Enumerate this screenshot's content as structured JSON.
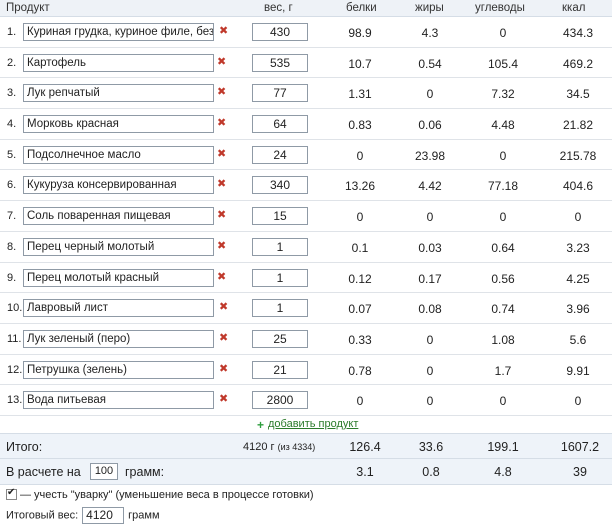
{
  "header": {
    "product": "Продукт",
    "weight": "вес, г",
    "protein": "белки",
    "fat": "жиры",
    "carbs": "углеводы",
    "kcal": "ккал"
  },
  "rows": [
    {
      "num": "1.",
      "name": "Куриная грудка, куриное филе, без",
      "weight": "430",
      "protein": "98.9",
      "fat": "4.3",
      "carbs": "0",
      "kcal": "434.3"
    },
    {
      "num": "2.",
      "name": "Картофель",
      "weight": "535",
      "protein": "10.7",
      "fat": "0.54",
      "carbs": "105.4",
      "kcal": "469.2"
    },
    {
      "num": "3.",
      "name": "Лук репчатый",
      "weight": "77",
      "protein": "1.31",
      "fat": "0",
      "carbs": "7.32",
      "kcal": "34.5"
    },
    {
      "num": "4.",
      "name": "Морковь красная",
      "weight": "64",
      "protein": "0.83",
      "fat": "0.06",
      "carbs": "4.48",
      "kcal": "21.82"
    },
    {
      "num": "5.",
      "name": "Подсолнечное масло",
      "weight": "24",
      "protein": "0",
      "fat": "23.98",
      "carbs": "0",
      "kcal": "215.78"
    },
    {
      "num": "6.",
      "name": "Кукуруза консервированная",
      "weight": "340",
      "protein": "13.26",
      "fat": "4.42",
      "carbs": "77.18",
      "kcal": "404.6"
    },
    {
      "num": "7.",
      "name": "Соль поваренная пищевая",
      "weight": "15",
      "protein": "0",
      "fat": "0",
      "carbs": "0",
      "kcal": "0"
    },
    {
      "num": "8.",
      "name": "Перец черный молотый",
      "weight": "1",
      "protein": "0.1",
      "fat": "0.03",
      "carbs": "0.64",
      "kcal": "3.23"
    },
    {
      "num": "9.",
      "name": "Перец молотый красный",
      "weight": "1",
      "protein": "0.12",
      "fat": "0.17",
      "carbs": "0.56",
      "kcal": "4.25"
    },
    {
      "num": "10.",
      "name": "Лавровый лист",
      "weight": "1",
      "protein": "0.07",
      "fat": "0.08",
      "carbs": "0.74",
      "kcal": "3.96"
    },
    {
      "num": "11.",
      "name": "Лук зеленый (перо)",
      "weight": "25",
      "protein": "0.33",
      "fat": "0",
      "carbs": "1.08",
      "kcal": "5.6"
    },
    {
      "num": "12.",
      "name": "Петрушка (зелень)",
      "weight": "21",
      "protein": "0.78",
      "fat": "0",
      "carbs": "1.7",
      "kcal": "9.91"
    },
    {
      "num": "13.",
      "name": "Вода питьевая",
      "weight": "2800",
      "protein": "0",
      "fat": "0",
      "carbs": "0",
      "kcal": "0"
    }
  ],
  "add_product": "добавить продукт",
  "totals": {
    "label": "Итого:",
    "weight": "4120 г",
    "weight_of": "(из 4334)",
    "protein": "126.4",
    "fat": "33.6",
    "carbs": "199.1",
    "kcal": "1607.2"
  },
  "per": {
    "label_before": "В расчете на",
    "amount": "100",
    "label_after": "грамм:",
    "protein": "3.1",
    "fat": "0.8",
    "carbs": "4.8",
    "kcal": "39"
  },
  "boil_option": "— учесть \"уварку\" (уменьшение веса в процессе готовки)",
  "final_weight": {
    "label": "Итоговый вес:",
    "value": "4120",
    "unit": "грамм"
  },
  "colors": {
    "header_bg": "#eef2f7",
    "delete": "#c0392b",
    "add_link": "#2a7a2a"
  }
}
